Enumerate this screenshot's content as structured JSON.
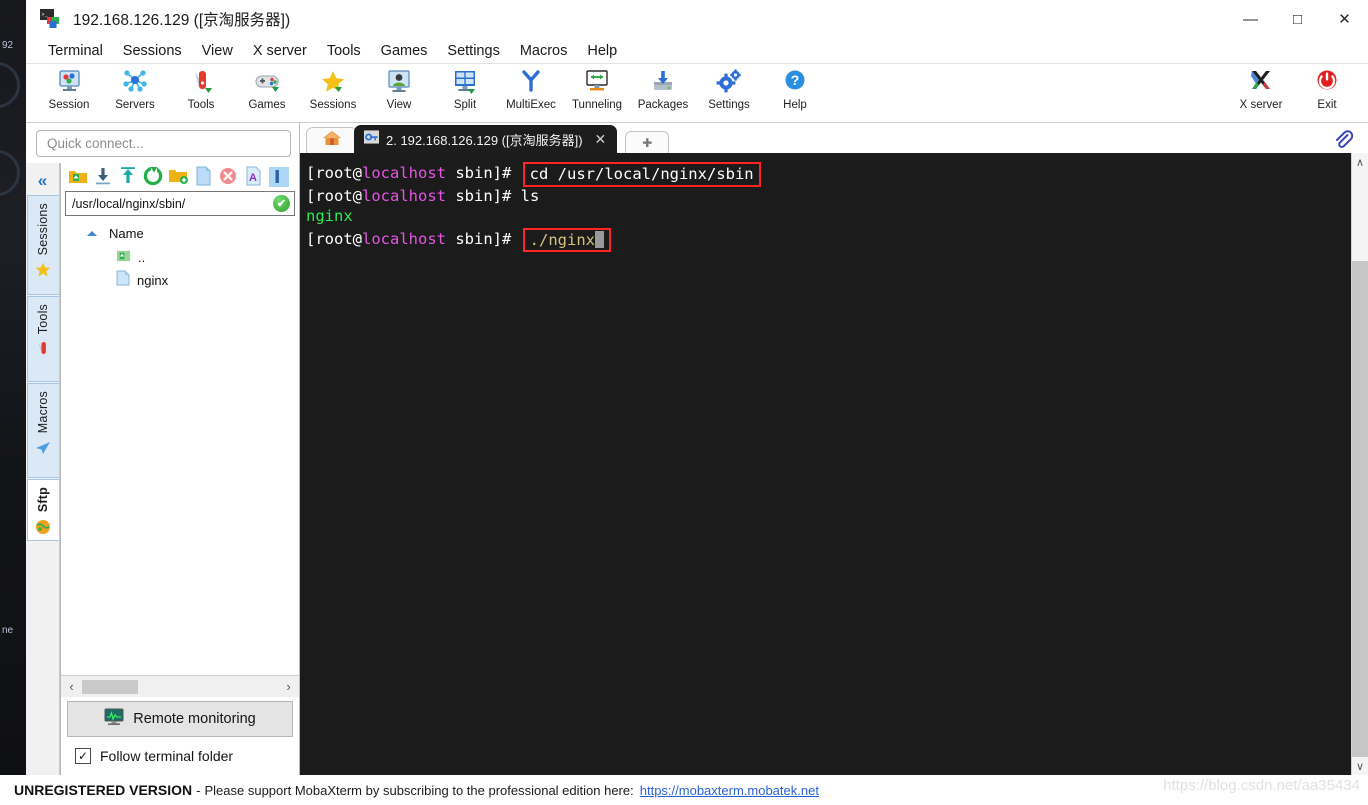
{
  "window": {
    "title": "192.168.126.129 ([京淘服务器])",
    "minimize": "—",
    "maximize": "□",
    "close": "✕"
  },
  "menubar": [
    {
      "label": "Terminal"
    },
    {
      "label": "Sessions"
    },
    {
      "label": "View"
    },
    {
      "label": "X server"
    },
    {
      "label": "Tools"
    },
    {
      "label": "Games"
    },
    {
      "label": "Settings"
    },
    {
      "label": "Macros"
    },
    {
      "label": "Help"
    }
  ],
  "toolbar": {
    "left": [
      {
        "label": "Session",
        "icon": "session-icon"
      },
      {
        "label": "Servers",
        "icon": "servers-icon"
      },
      {
        "label": "Tools",
        "icon": "tools-icon"
      },
      {
        "label": "Games",
        "icon": "games-icon"
      },
      {
        "label": "Sessions",
        "icon": "sessions-star-icon"
      },
      {
        "label": "View",
        "icon": "view-icon"
      },
      {
        "label": "Split",
        "icon": "split-icon"
      },
      {
        "label": "MultiExec",
        "icon": "multiexec-icon"
      },
      {
        "label": "Tunneling",
        "icon": "tunneling-icon"
      },
      {
        "label": "Packages",
        "icon": "packages-icon"
      },
      {
        "label": "Settings",
        "icon": "settings-gear-icon"
      },
      {
        "label": "Help",
        "icon": "help-icon"
      }
    ],
    "right": [
      {
        "label": "X server",
        "icon": "x-server-icon"
      },
      {
        "label": "Exit",
        "icon": "exit-power-icon"
      }
    ]
  },
  "sidebar": {
    "quick_connect_placeholder": "Quick connect...",
    "collapse_glyph": "«",
    "vtabs": [
      {
        "label": "Sessions",
        "icon": "star-icon",
        "active": false
      },
      {
        "label": "Tools",
        "icon": "knife-icon",
        "active": false
      },
      {
        "label": "Macros",
        "icon": "paper-plane-icon",
        "active": false
      },
      {
        "label": "Sftp",
        "icon": "globe-icon",
        "active": true
      }
    ]
  },
  "filebrowser": {
    "toolbar_icons": [
      "parent-folder-icon",
      "download-icon",
      "upload-icon",
      "refresh-icon",
      "new-folder-icon",
      "new-file-icon",
      "delete-icon",
      "rename-text-icon",
      "more-icon"
    ],
    "path": "/usr/local/nginx/sbin/",
    "path_ok_glyph": "✔",
    "column_header": "Name",
    "rows": [
      {
        "name": "..",
        "icon": "parent-folder-icon"
      },
      {
        "name": "nginx",
        "icon": "file-icon"
      }
    ],
    "scroll_left_glyph": "‹",
    "scroll_right_glyph": "›",
    "remote_monitoring_label": "Remote monitoring",
    "follow_terminal_label": "Follow terminal folder",
    "follow_terminal_checked": true,
    "checkmark_glyph": "✓"
  },
  "tabs": {
    "home_icon": "home-icon",
    "active": {
      "label": "2.  192.168.126.129  ([京淘服务器])",
      "icon": "ssh-key-icon",
      "close_glyph": "✕"
    },
    "new_tab_glyph": "✚",
    "clip_icon": "paperclip-icon"
  },
  "terminal": {
    "prompt_open": "[",
    "prompt_user": "root@",
    "prompt_host": "localhost",
    "prompt_tail": " sbin]# ",
    "lines": [
      {
        "type": "prompt_cmd",
        "command": "cd /usr/local/nginx/sbin",
        "highlight": true
      },
      {
        "type": "prompt_cmd",
        "command": "ls",
        "highlight": false
      },
      {
        "type": "output",
        "text": "nginx",
        "color": "green"
      },
      {
        "type": "prompt_cmd",
        "command": "./nginx",
        "highlight": true,
        "cursor": true
      }
    ],
    "scroll_up_glyph": "∧",
    "scroll_down_glyph": "∨"
  },
  "statusbar": {
    "badge": "UNREGISTERED VERSION",
    "dash": "-",
    "message": "Please support MobaXterm by subscribing to the professional edition here:",
    "link": "https://mobaxterm.mobatek.net",
    "watermark": "https://blog.csdn.net/aa35434"
  },
  "desktop": {
    "left_text_top": "92",
    "left_text_mid": "ne"
  },
  "colors": {
    "accent_blue": "#2472c8",
    "terminal_bg": "#1b1b1b",
    "host_magenta": "#e455e4",
    "output_green": "#2bea4f",
    "highlight_red": "#ff2424",
    "link_blue": "#2b5fd9"
  }
}
